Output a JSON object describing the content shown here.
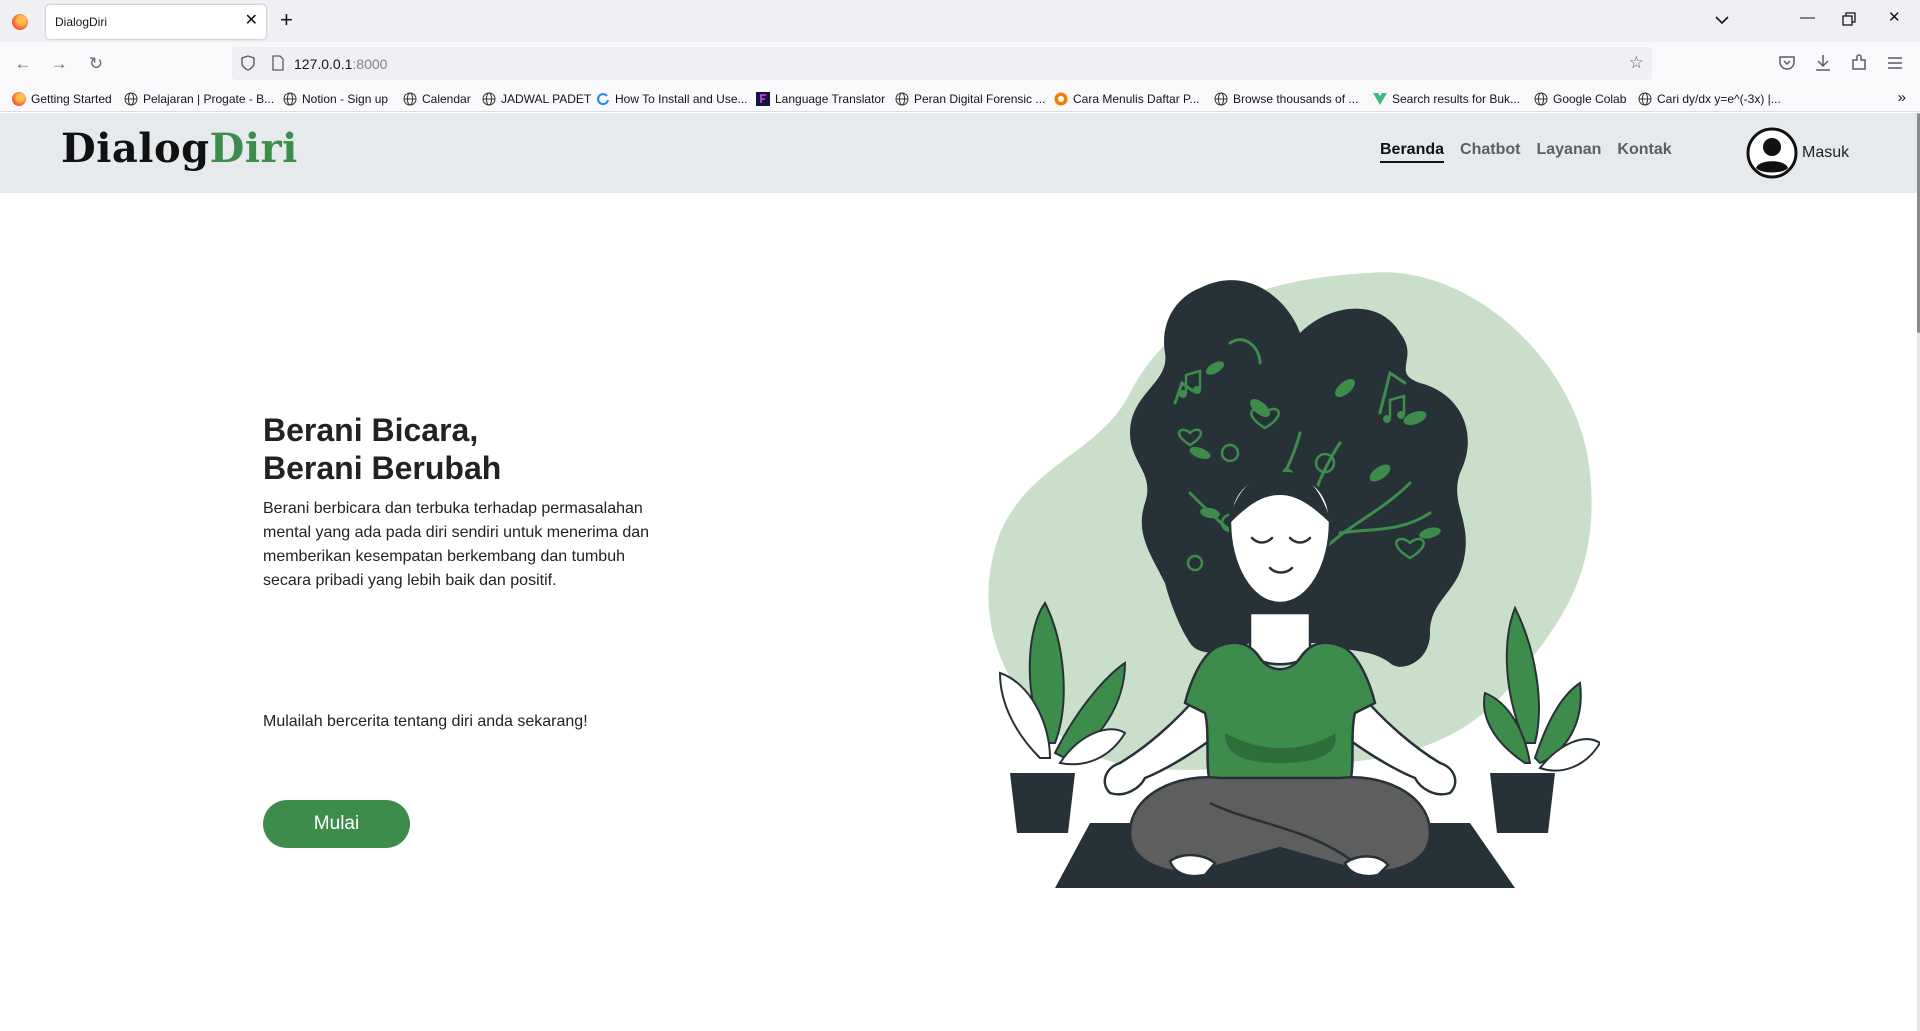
{
  "browser": {
    "tab_title": "DialogDiri",
    "url_host": "127.0.0.1",
    "url_port": ":8000",
    "bookmarks": [
      "Getting Started",
      "Pelajaran | Progate - B...",
      "Notion - Sign up",
      "Calendar",
      "JADWAL PADET",
      "How To Install and Use...",
      "Language Translator",
      "Peran Digital Forensic ...",
      "Cara Menulis Daftar P...",
      "Browse thousands of ...",
      "Search results for Buk...",
      "Google Colab",
      "Cari dy/dx y=e^(-3x) |..."
    ]
  },
  "header": {
    "logo_main": "Dialog",
    "logo_accent": "Diri",
    "nav": [
      "Beranda",
      "Chatbot",
      "Layanan",
      "Kontak"
    ],
    "active_nav": "Beranda",
    "account_label": "Masuk"
  },
  "hero": {
    "title_line1": "Berani Bicara,",
    "title_line2": "Berani Berubah",
    "description": "Berani berbicara dan terbuka terhadap permasalahan mental yang ada pada diri sendiri untuk menerima dan memberikan kesempatan berkembang dan tumbuh secara pribadi yang lebih baik dan positif.",
    "cta_text": "Mulailah bercerita tentang diri anda sekarang!",
    "button_label": "Mulai"
  },
  "colors": {
    "brand_green": "#3e8c4c",
    "header_bg": "#e7eaed",
    "blob_green": "#c9dfca",
    "hair": "#263238"
  }
}
